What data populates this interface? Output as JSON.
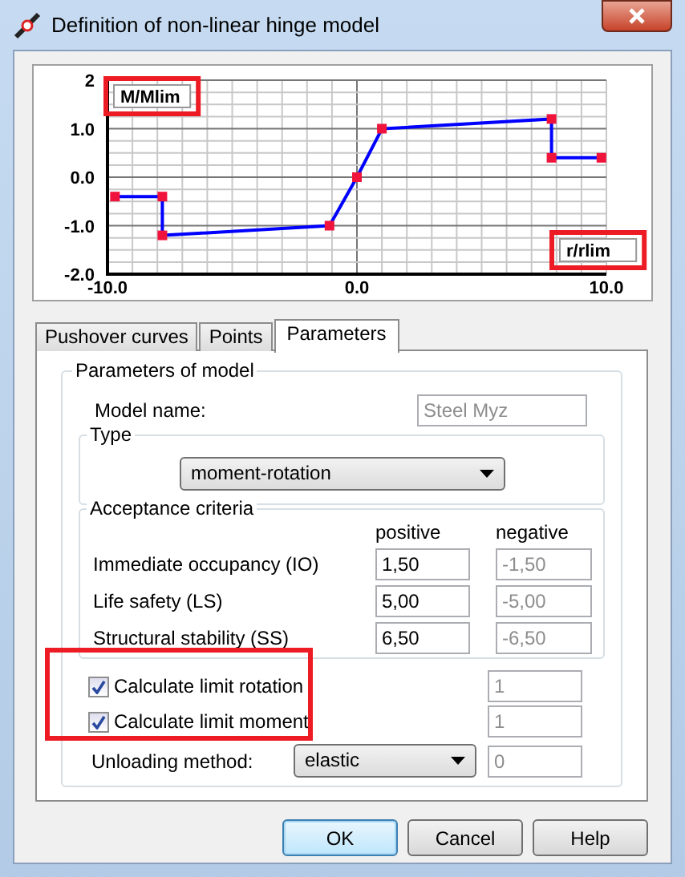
{
  "window": {
    "title": "Definition of non-linear hinge model"
  },
  "chart": {
    "chart_data": {
      "type": "line",
      "xlabel": "r/rlim",
      "ylabel": "M/Mlim",
      "xlim": [
        -10,
        10
      ],
      "ylim": [
        -2,
        2
      ],
      "x": [
        -9.7,
        -7.8,
        -7.8,
        -1.1,
        0,
        1.0,
        7.8,
        7.8,
        9.8
      ],
      "grid": true,
      "series": [
        {
          "color": "#0000ff",
          "marker": "square",
          "values": [
            -0.4,
            -0.4,
            -1.2,
            -1.0,
            0,
            1.0,
            1.2,
            0.4,
            0.4
          ]
        }
      ],
      "xticks": [
        {
          "value": -10,
          "label": "-10.0"
        },
        {
          "value": 0,
          "label": "0.0"
        },
        {
          "value": 10,
          "label": "10.0"
        }
      ],
      "yticks": [
        {
          "value": 2,
          "label": "2"
        },
        {
          "value": 1,
          "label": "1.0"
        },
        {
          "value": 0,
          "label": "0.0"
        },
        {
          "value": -1,
          "label": "-1.0"
        },
        {
          "value": -2,
          "label": "-2.0"
        }
      ]
    }
  },
  "tabs": [
    {
      "label": "Pushover curves",
      "selected": false
    },
    {
      "label": "Points",
      "selected": false
    },
    {
      "label": "Parameters",
      "selected": true
    }
  ],
  "parameters": {
    "title": "Parameters of model",
    "model_name": {
      "label": "Model name:",
      "value": "Steel Myz",
      "disabled": true
    },
    "type": {
      "title": "Type",
      "value": "moment-rotation"
    },
    "acceptance": {
      "title": "Acceptance criteria",
      "columns": [
        "positive",
        "negative"
      ],
      "rows": [
        {
          "label": "Immediate occupancy (IO)",
          "positive": "1,50",
          "negative": "-1,50",
          "negative_disabled": true
        },
        {
          "label": "Life safety (LS)",
          "positive": "5,00",
          "negative": "-5,00",
          "negative_disabled": true
        },
        {
          "label": "Structural stability (SS)",
          "positive": "6,50",
          "negative": "-6,50",
          "negative_disabled": true
        }
      ]
    },
    "limits": [
      {
        "label": "Calculate limit rotation",
        "checked": true,
        "value": "1",
        "value_disabled": true
      },
      {
        "label": "Calculate limit moment",
        "checked": true,
        "value": "1",
        "value_disabled": true
      }
    ],
    "unloading": {
      "label": "Unloading method:",
      "value": "elastic",
      "extra": "0",
      "extra_disabled": true
    }
  },
  "buttons": [
    {
      "label": "OK",
      "default": true
    },
    {
      "label": "Cancel",
      "default": false
    },
    {
      "label": "Help",
      "default": false
    }
  ]
}
